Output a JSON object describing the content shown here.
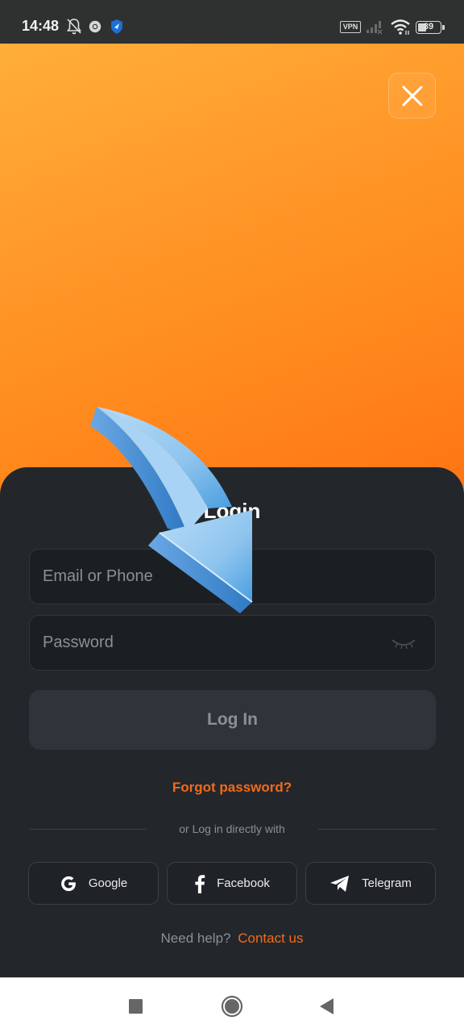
{
  "status_bar": {
    "time": "14:48",
    "icons": [
      "bell-off-icon",
      "chrome-icon",
      "shield-icon"
    ],
    "vpn_label": "VPN",
    "battery_level": "39",
    "battery_percent": 39
  },
  "header": {
    "close_icon": "close-icon"
  },
  "login_sheet": {
    "title": "Login",
    "email_placeholder": "Email or Phone",
    "email_value": "",
    "password_placeholder": "Password",
    "password_value": "",
    "password_toggle_icon": "eye-closed-icon",
    "login_button_label": "Log In",
    "forgot_password_label": "Forgot password?",
    "divider_text": "or Log in directly with",
    "social_buttons": [
      {
        "label": "Google",
        "icon": "google-icon"
      },
      {
        "label": "Facebook",
        "icon": "facebook-icon"
      },
      {
        "label": "Telegram",
        "icon": "telegram-icon"
      }
    ],
    "help_text": "Need help?",
    "contact_label": "Contact us"
  },
  "overlay": {
    "annotation_icon": "curved-arrow-icon"
  },
  "nav_bar": {
    "buttons": [
      "recents",
      "home",
      "back"
    ]
  },
  "colors": {
    "accent": "#f26a1b",
    "hero_top": "#ffae3a",
    "hero_bottom": "#ff7414",
    "sheet_bg": "#23272b"
  }
}
